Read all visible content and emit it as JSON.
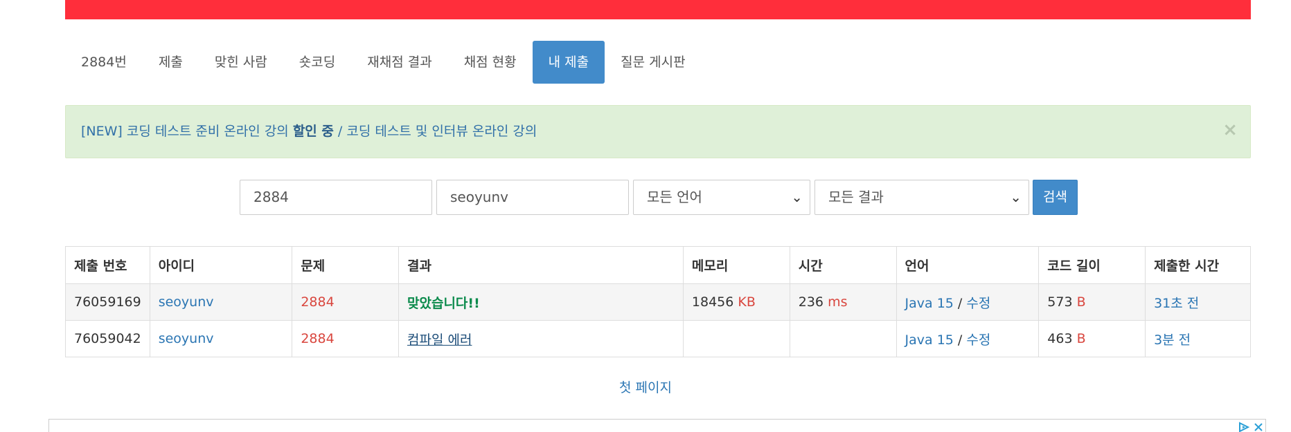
{
  "nav": {
    "items": [
      "2884번",
      "제출",
      "맞힌 사람",
      "숏코딩",
      "재채점 결과",
      "채점 현황",
      "내 제출",
      "질문 게시판"
    ],
    "active_index": 6
  },
  "alert": {
    "prefix": "[NEW] 코딩 테스트 준비 온라인 강의 ",
    "highlight": "할인 중",
    "separator": " / ",
    "suffix": "코딩 테스트 및 인터뷰 온라인 강의",
    "close": "×"
  },
  "search": {
    "problem_id": "2884",
    "user_id": "seoyunv",
    "language": "모든 언어",
    "result": "모든 결과",
    "button": "검색"
  },
  "table": {
    "headers": [
      "제출 번호",
      "아이디",
      "문제",
      "결과",
      "메모리",
      "시간",
      "언어",
      "코드 길이",
      "제출한 시간"
    ],
    "rows": [
      {
        "id": "76059169",
        "user": "seoyunv",
        "problem": "2884",
        "result": "맞았습니다!!",
        "memory": "18456",
        "memory_unit": "KB",
        "time": "236",
        "time_unit": "ms",
        "language": "Java 15",
        "edit": "수정",
        "code_length": "573",
        "code_unit": "B",
        "submitted": "31초 전"
      },
      {
        "id": "76059042",
        "user": "seoyunv",
        "problem": "2884",
        "result": "컴파일 에러",
        "memory": "",
        "memory_unit": "",
        "time": "",
        "time_unit": "",
        "language": "Java 15",
        "edit": "수정",
        "code_length": "463",
        "code_unit": "B",
        "submitted": "3분 전"
      }
    ]
  },
  "pagination": {
    "first_page": "첫 페이지"
  },
  "colors": {
    "top_bar": "#ff2e3b",
    "accent": "#428bca",
    "success": "#0a8a4b",
    "alert_bg": "#dff0d8"
  },
  "icons": {
    "ad_choices": "adchoices-icon",
    "ad_close": "close-icon"
  }
}
